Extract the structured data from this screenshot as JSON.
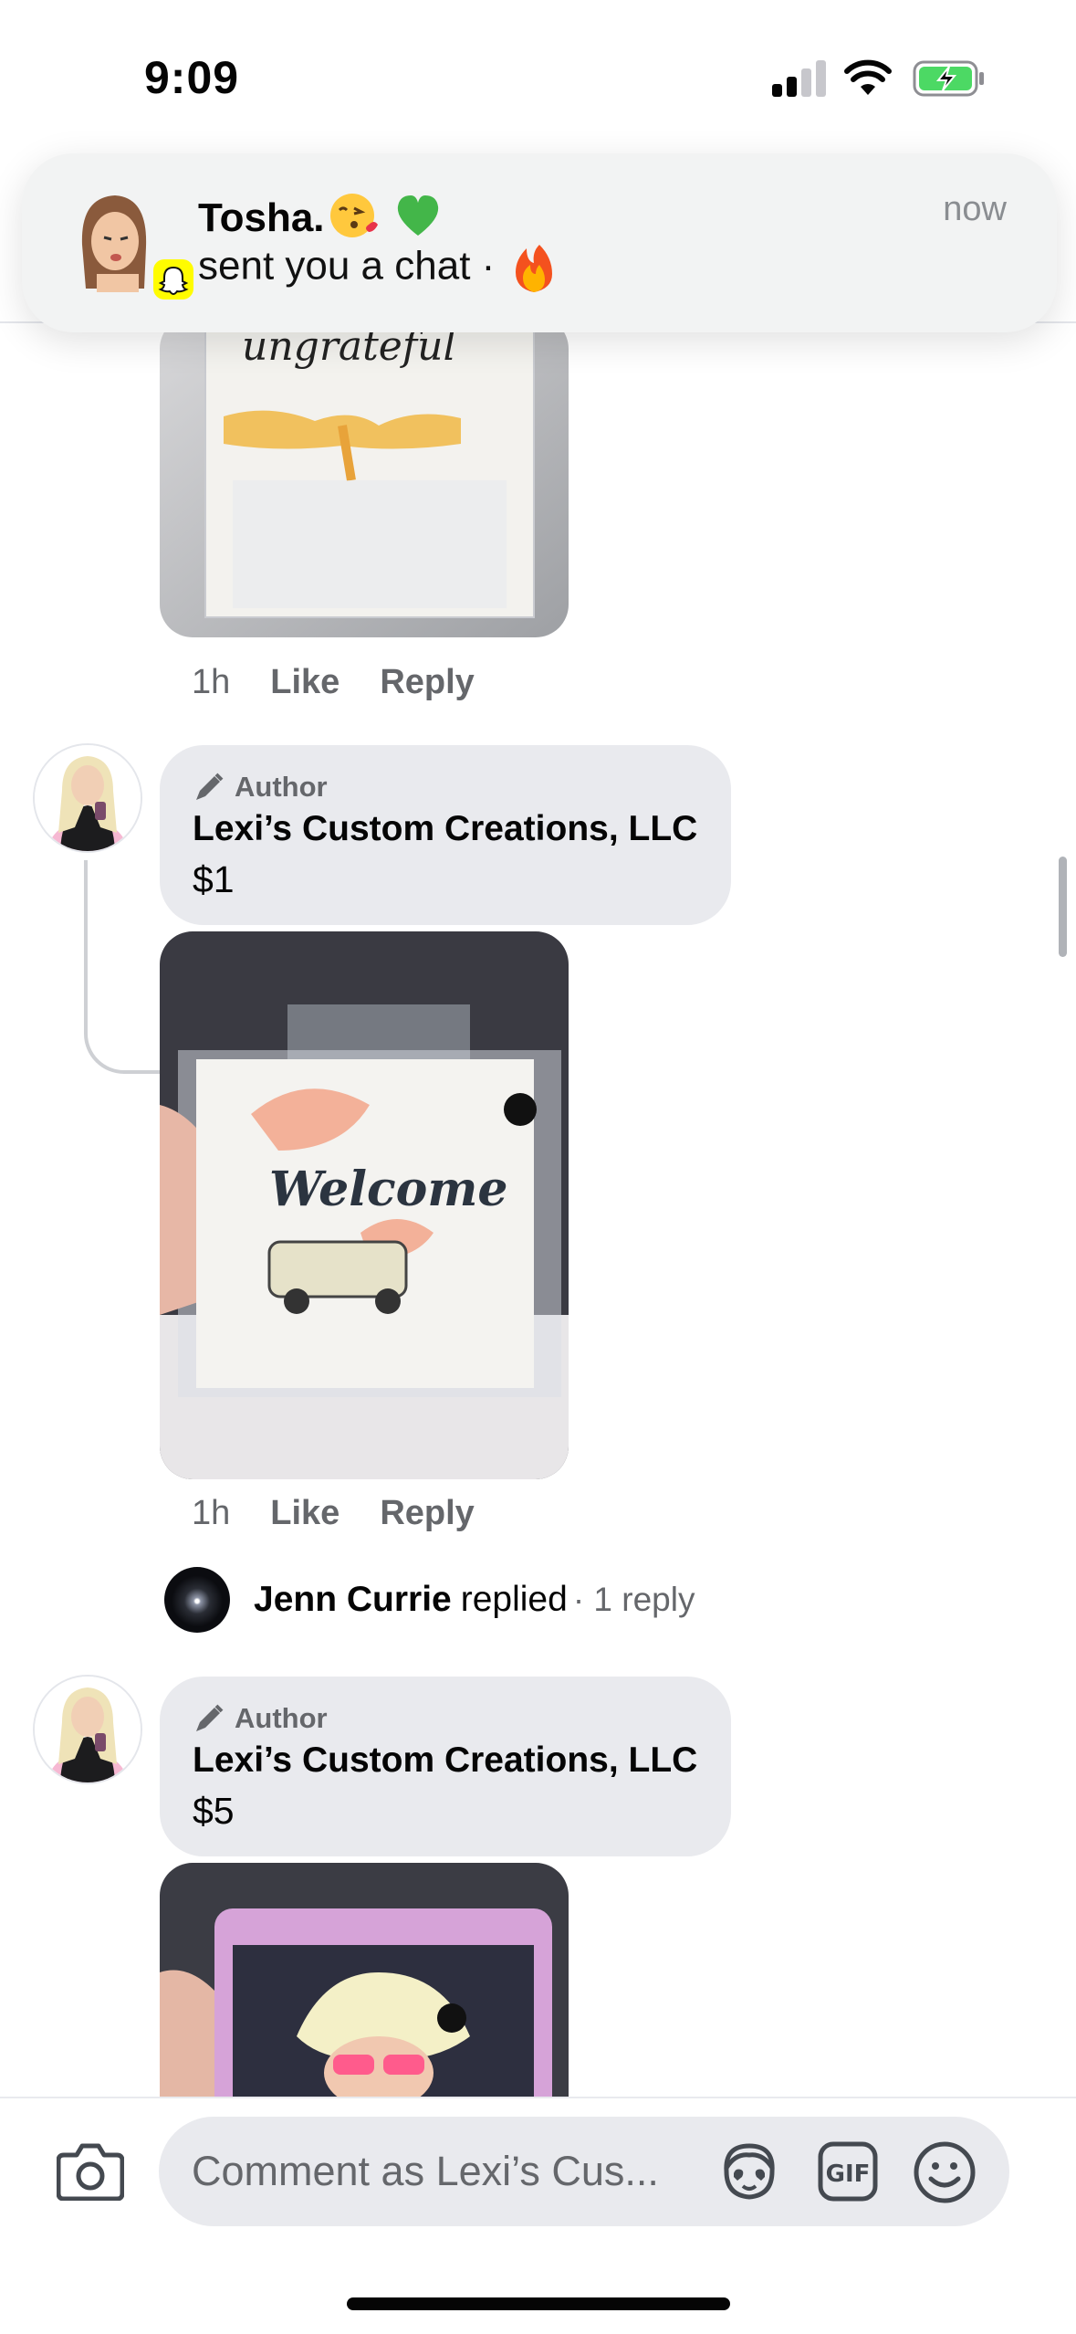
{
  "status_bar": {
    "time": "9:09",
    "battery_color": "#4cd964"
  },
  "notification": {
    "app": "snapchat",
    "title": "Tosha.",
    "title_emojis": [
      "kiss-emoji",
      "green-heart-emoji"
    ],
    "body": "sent you a chat ·",
    "body_emoji": "fire-emoji",
    "time": "now",
    "badge_color": "#fffc00"
  },
  "comments": [
    {
      "image": "tea-towel-ungrateful",
      "image_text": "ungrateful",
      "time": "1h",
      "like_label": "Like",
      "reply_label": "Reply"
    },
    {
      "badge": "Author",
      "name": "Lexi’s Custom Creations, LLC",
      "text": "$1",
      "image": "tea-towel-welcome",
      "image_text": "Welcome",
      "time": "1h",
      "like_label": "Like",
      "reply_label": "Reply",
      "replies": {
        "name": "Jenn Currie",
        "verb": "replied",
        "count": "· 1 reply"
      }
    },
    {
      "badge": "Author",
      "name": "Lexi’s Custom Creations, LLC",
      "text": "$5",
      "image": "bag-woman-sunglasses"
    }
  ],
  "composer": {
    "placeholder": "Comment as Lexi’s Cus...",
    "gif_label": "GIF"
  },
  "colors": {
    "bubble": "#e9eaee",
    "secondary_text": "#65676b",
    "thread_line": "#ced0d4"
  }
}
